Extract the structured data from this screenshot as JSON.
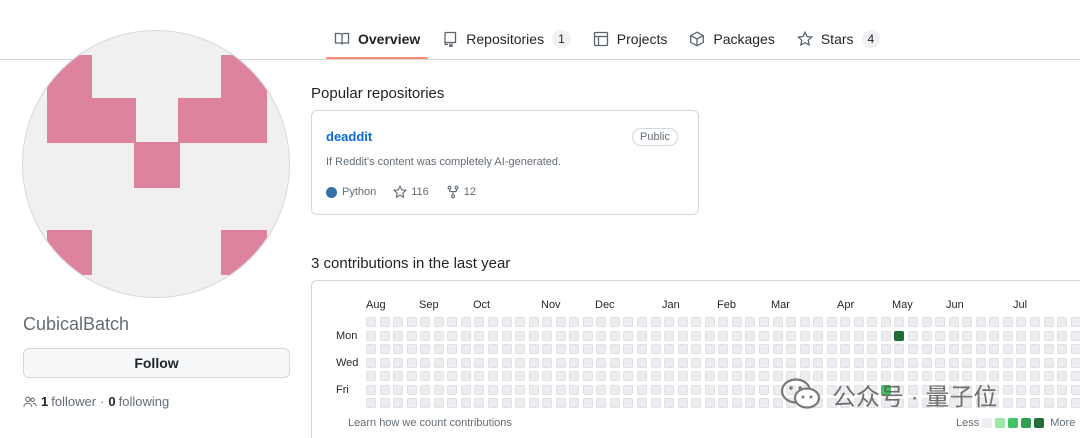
{
  "nav": {
    "tabs": [
      {
        "label": "Overview",
        "icon": "book-icon",
        "active": true
      },
      {
        "label": "Repositories",
        "icon": "repo-icon",
        "count": "1"
      },
      {
        "label": "Projects",
        "icon": "table-icon"
      },
      {
        "label": "Packages",
        "icon": "package-icon"
      },
      {
        "label": "Stars",
        "icon": "star-icon",
        "count": "4"
      }
    ]
  },
  "profile": {
    "username": "CubicalBatch",
    "follow_label": "Follow",
    "followers": "1",
    "followers_label": "follower",
    "following": "0",
    "following_label": "following",
    "separator": "·",
    "avatar_color": "#de839d"
  },
  "popular": {
    "title": "Popular repositories",
    "repos": [
      {
        "name": "deaddit",
        "visibility": "Public",
        "description": "If Reddit's content was completely AI-generated.",
        "language": "Python",
        "language_color": "#3572a5",
        "stars": "116",
        "forks": "12"
      }
    ]
  },
  "contributions": {
    "title": "3 contributions in the last year",
    "months": [
      "Aug",
      "Sep",
      "Oct",
      "Nov",
      "Dec",
      "Jan",
      "Feb",
      "Mar",
      "Apr",
      "May",
      "Jun",
      "Jul"
    ],
    "day_labels": [
      "Mon",
      "Wed",
      "Fri"
    ],
    "weeks_shown": 53,
    "active_cells": [
      {
        "week": 39,
        "day": 1,
        "level": 4
      },
      {
        "week": 38,
        "day": 5,
        "level": 2
      }
    ],
    "learn_link": "Learn how we count contributions",
    "legend_less": "Less",
    "legend_more": "More",
    "level_colors": [
      "#ebedf0",
      "#9be9a8",
      "#40c463",
      "#30a14e",
      "#216e39"
    ]
  },
  "watermark": {
    "text": "公众号 · 量子位",
    "icon": "wechat-icon"
  }
}
